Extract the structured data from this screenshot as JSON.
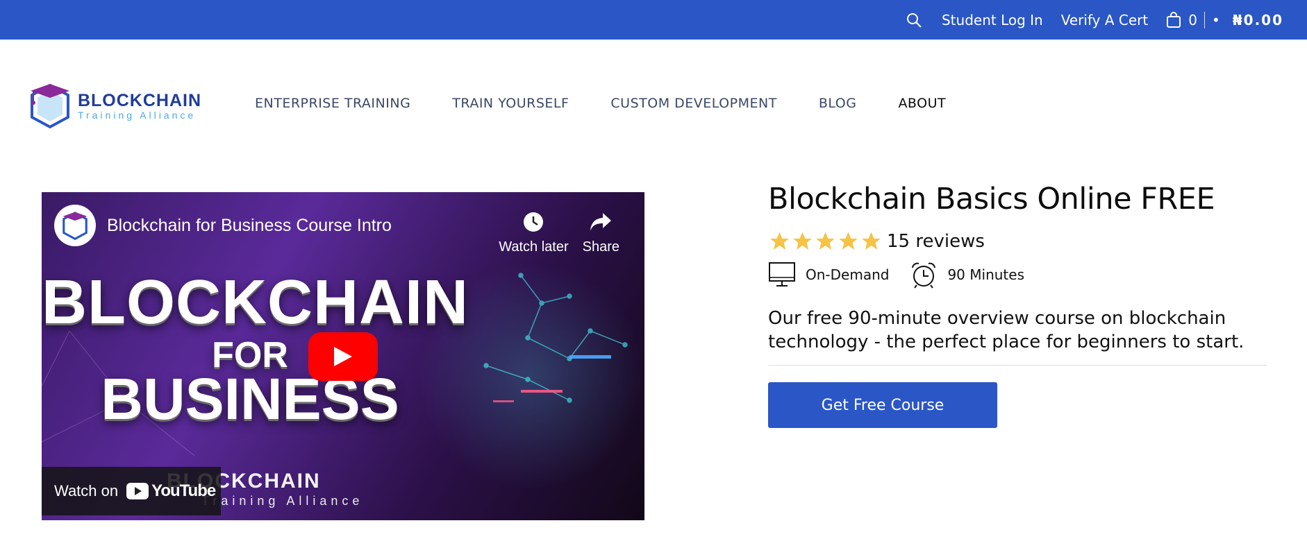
{
  "topbar": {
    "login": "Student Log In",
    "verify": "Verify A Cert",
    "cart_count": "0",
    "dot": "•",
    "price": "₦0.00"
  },
  "logo": {
    "line1": "BLOCKCHAIN",
    "line2": "Training Alliance"
  },
  "nav": {
    "items": [
      "ENTERPRISE TRAINING",
      "TRAIN YOURSELF",
      "CUSTOM DEVELOPMENT",
      "BLOG",
      "ABOUT"
    ]
  },
  "video": {
    "title": "Blockchain for Business Course Intro",
    "watch_later": "Watch later",
    "share": "Share",
    "big1": "BLOCKCHAIN",
    "big2": "FOR",
    "big3": "BUSINESS",
    "foot1": "BLOCKCHAIN",
    "foot2": "Training Alliance",
    "watch_on": "Watch on",
    "youtube": "YouTube"
  },
  "course": {
    "title": "Blockchain Basics Online FREE",
    "rating_stars": 5,
    "reviews": "15 reviews",
    "mode": "On-Demand",
    "duration": "90 Minutes",
    "description": "Our free 90-minute overview course on blockchain technology - the perfect place for beginners to start.",
    "cta": "Get Free Course"
  },
  "colors": {
    "brand_blue": "#2a56c6",
    "star": "#f6c344",
    "youtube_red": "#ff0000"
  }
}
